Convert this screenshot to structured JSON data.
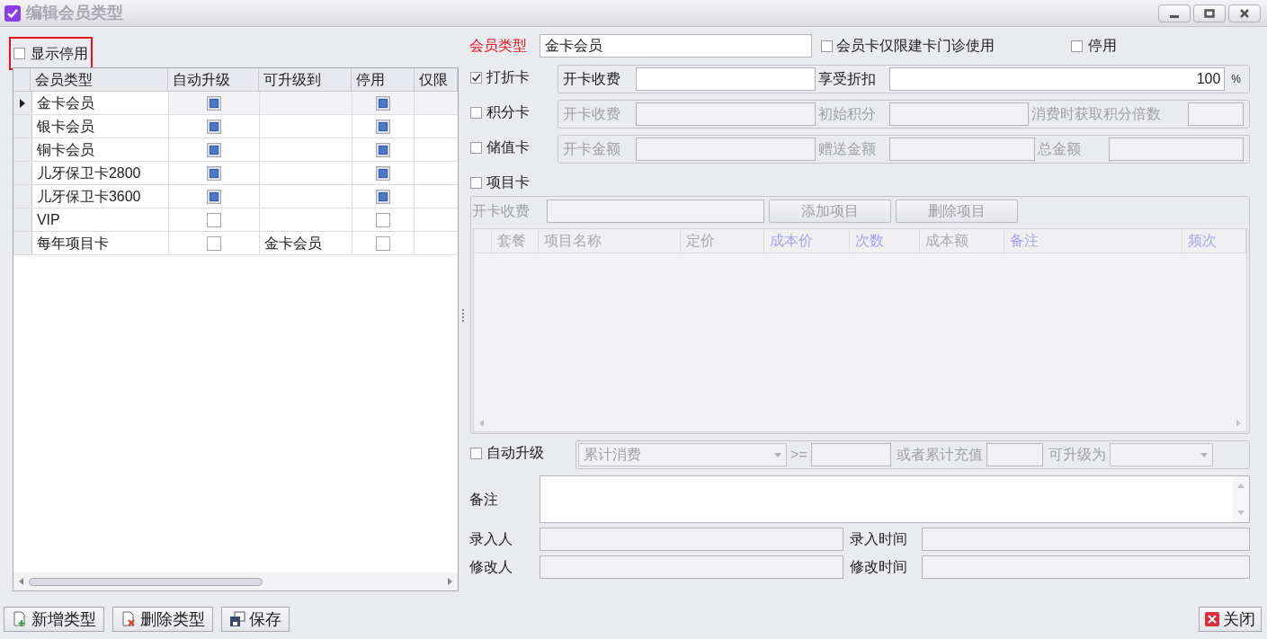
{
  "window": {
    "title": "编辑会员类型"
  },
  "show_disabled": {
    "label": "显示停用",
    "checked": false,
    "highlighted": true
  },
  "grid": {
    "columns": [
      "会员类型",
      "自动升级",
      "可升级到",
      "停用",
      "仅限"
    ],
    "rows": [
      {
        "name": "金卡会员",
        "auto_upgrade": true,
        "disabled": true,
        "selected": true
      },
      {
        "name": "银卡会员",
        "auto_upgrade": true,
        "disabled": true,
        "selected": false
      },
      {
        "name": "铜卡会员",
        "auto_upgrade": true,
        "disabled": true,
        "selected": false
      },
      {
        "name": "儿牙保卫卡2800",
        "auto_upgrade": true,
        "disabled": true,
        "selected": false
      },
      {
        "name": "儿牙保卫卡3600",
        "auto_upgrade": true,
        "disabled": true,
        "selected": false
      },
      {
        "name": "VIP",
        "auto_upgrade": false,
        "disabled": false,
        "selected": false
      },
      {
        "name": "每年项目卡",
        "auto_upgrade": false,
        "upgrade_to": "金卡会员",
        "disabled": false,
        "selected": false
      }
    ]
  },
  "member_type": {
    "label": "会员类型",
    "value": "金卡会员"
  },
  "clinic_only": {
    "label": "会员卡仅限建卡门诊使用",
    "checked": false
  },
  "disabled": {
    "label": "停用",
    "checked": false
  },
  "card_types": [
    {
      "label": "打折卡",
      "checked": true,
      "fields": [
        {
          "label": "开卡收费"
        },
        {
          "label": "享受折扣",
          "value": "100",
          "suffix": "%"
        }
      ]
    },
    {
      "label": "积分卡",
      "checked": false,
      "fields": [
        {
          "label": "开卡收费"
        },
        {
          "label": "初始积分"
        },
        {
          "label": "消费时获取积分倍数"
        }
      ]
    },
    {
      "label": "储值卡",
      "checked": false,
      "fields": [
        {
          "label": "开卡金额"
        },
        {
          "label": "赠送金额"
        },
        {
          "label": "总金额"
        }
      ]
    }
  ],
  "project_card": {
    "label": "项目卡",
    "checked": false,
    "fee_label": "开卡收费",
    "buttons": [
      "添加项目",
      "删除项目"
    ],
    "columns": [
      {
        "label": "套餐",
        "highlighted": false
      },
      {
        "label": "项目名称",
        "highlighted": false
      },
      {
        "label": "定价",
        "highlighted": false
      },
      {
        "label": "成本价",
        "highlighted": true
      },
      {
        "label": "次数",
        "highlighted": true
      },
      {
        "label": "成本额",
        "highlighted": false
      },
      {
        "label": "备注",
        "highlighted": true
      },
      {
        "label": "频次",
        "highlighted": true
      }
    ]
  },
  "auto_upgrade": {
    "label": "自动升级",
    "checked": false,
    "basis": "累计消费",
    "operator": ">=",
    "or_label": "或者累计充值",
    "target_label": "可升级为"
  },
  "remark": {
    "label": "备注"
  },
  "audit": [
    {
      "label": "录入人"
    },
    {
      "label": "录入时间"
    },
    {
      "label": "修改人"
    },
    {
      "label": "修改时间"
    }
  ],
  "footer": {
    "buttons": [
      {
        "label": "新增类型",
        "kind": "add"
      },
      {
        "label": "删除类型",
        "kind": "delete"
      },
      {
        "label": "保存",
        "kind": "save"
      }
    ],
    "close": "关闭"
  }
}
